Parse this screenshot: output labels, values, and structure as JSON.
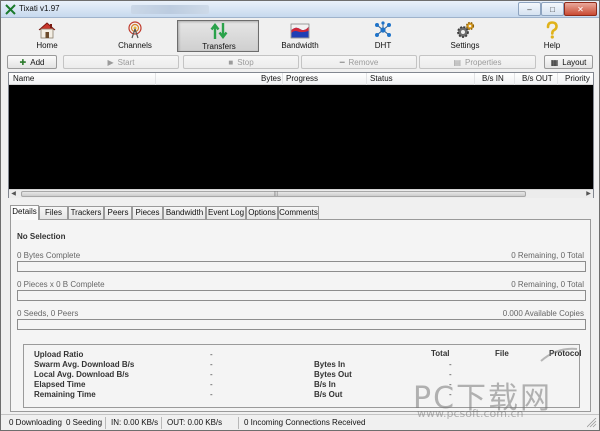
{
  "window": {
    "title": "Tixati v1.97",
    "controls": {
      "minimize": "–",
      "maximize": "□",
      "close": "✕"
    }
  },
  "toolbar": {
    "items": [
      {
        "label": "Home",
        "icon": "home-icon"
      },
      {
        "label": "Channels",
        "icon": "channels-antenna-icon"
      },
      {
        "label": "Transfers",
        "icon": "transfers-arrows-icon",
        "active": true
      },
      {
        "label": "Bandwidth",
        "icon": "bandwidth-graph-icon"
      },
      {
        "label": "DHT",
        "icon": "dht-network-icon"
      },
      {
        "label": "Settings",
        "icon": "settings-gears-icon"
      },
      {
        "label": "Help",
        "icon": "help-question-icon"
      }
    ]
  },
  "actions": {
    "add": "Add",
    "start": "Start",
    "stop": "Stop",
    "remove": "Remove",
    "properties": "Properties",
    "layout": "Layout"
  },
  "transfers_list": {
    "columns": [
      "Name",
      "Bytes",
      "Progress",
      "Status",
      "B/s IN",
      "B/s OUT",
      "Priority"
    ],
    "rows": []
  },
  "tabs": [
    "Details",
    "Files",
    "Trackers",
    "Peers",
    "Pieces",
    "Bandwidth",
    "Event Log",
    "Options",
    "Comments"
  ],
  "active_tab": "Details",
  "details": {
    "selection": "No Selection",
    "bytes_complete": "0 Bytes Complete",
    "bytes_remaining": "0 Remaining,  0 Total",
    "pieces_complete": "0 Pieces  x  0 B Complete",
    "pieces_remaining": "0 Remaining,  0 Total",
    "seeds_peers": "0 Seeds, 0 Peers",
    "available_copies": "0.000 Available Copies",
    "stats": {
      "left_labels": [
        "Upload Ratio",
        "Swarm Avg. Download B/s",
        "Local Avg. Download B/s",
        "Elapsed Time",
        "Remaining Time"
      ],
      "left_values": [
        "-",
        "-",
        "-",
        "-",
        "-"
      ],
      "right_labels": [
        "Bytes In",
        "Bytes Out",
        "B/s In",
        "B/s Out"
      ],
      "headers": [
        "Total",
        "File",
        "Protocol"
      ],
      "right_values": [
        "-",
        "-",
        "-",
        "-"
      ]
    }
  },
  "statusbar": {
    "downloading": "0 Downloading",
    "seeding": "0 Seeding",
    "in_rate": "IN: 0.00 KB/s",
    "out_rate": "OUT: 0.00 KB/s",
    "incoming": "0 Incoming Connections Received"
  },
  "watermark": {
    "text": "PC下载网",
    "url": "www.pcsoft.com.cn"
  }
}
